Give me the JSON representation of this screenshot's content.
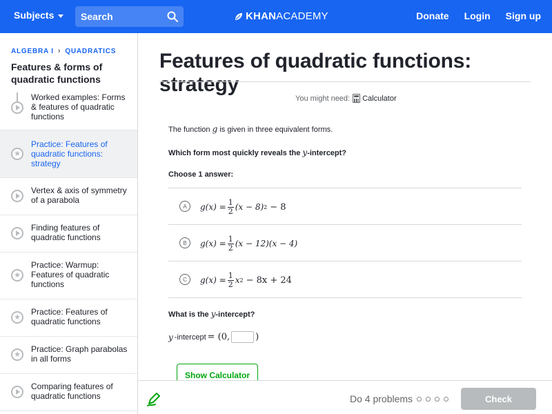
{
  "topbar": {
    "subjects_label": "Subjects",
    "search_placeholder": "Search",
    "logo_bold": "KHAN",
    "logo_light": "ACADEMY",
    "donate": "Donate",
    "login": "Login",
    "signup": "Sign up"
  },
  "sidebar": {
    "breadcrumb": [
      "ALGEBRA I",
      "QUADRATICS"
    ],
    "unit_title": "Features & forms of quadratic functions",
    "items": [
      {
        "label": "Worked examples: Forms & features of quadratic functions",
        "kind": "video",
        "active": false
      },
      {
        "label": "Practice: Features of quadratic functions: strategy",
        "kind": "practice",
        "active": true
      },
      {
        "label": "Vertex & axis of symmetry of a parabola",
        "kind": "video",
        "active": false
      },
      {
        "label": "Finding features of quadratic functions",
        "kind": "video",
        "active": false
      },
      {
        "label": "Practice: Warmup: Features of quadratic functions",
        "kind": "practice",
        "active": false
      },
      {
        "label": "Practice: Features of quadratic functions",
        "kind": "practice",
        "active": false
      },
      {
        "label": "Practice: Graph parabolas in all forms",
        "kind": "practice",
        "active": false
      },
      {
        "label": "Comparing features of quadratic functions",
        "kind": "video",
        "active": false
      }
    ]
  },
  "exercise": {
    "title": "Features of quadratic functions: strategy",
    "you_might_need": "You might need:",
    "calculator": "Calculator",
    "intro_before": "The function",
    "intro_var": "g",
    "intro_after": "is given in three equivalent forms.",
    "question_before": "Which form most quickly reveals the",
    "question_var": "y",
    "question_after": "-intercept?",
    "choose": "Choose 1 answer:",
    "choices": [
      {
        "letter": "A",
        "lhs": "g(x) =",
        "frac_num": "1",
        "frac_den": "2",
        "rhs": "(x − 8)",
        "sup": "2",
        "tail": "− 8"
      },
      {
        "letter": "B",
        "lhs": "g(x) =",
        "frac_num": "1",
        "frac_den": "2",
        "rhs": "(x − 12)(x − 4)",
        "sup": "",
        "tail": ""
      },
      {
        "letter": "C",
        "lhs": "g(x) =",
        "frac_num": "1",
        "frac_den": "2",
        "rhs": "x",
        "sup": "2",
        "tail": "− 8x + 24"
      }
    ],
    "second_question_before": "What is the",
    "second_question_var": "y",
    "second_question_after": "-intercept?",
    "answer_var": "y",
    "answer_label": "-intercept",
    "answer_prefix": "= (0,",
    "answer_suffix": ")",
    "answer_value": "",
    "show_calculator": "Show Calculator"
  },
  "footer": {
    "progress_text": "Do 4 problems",
    "progress_dots": 4,
    "check": "Check"
  },
  "colors": {
    "brand_blue": "#1865f2",
    "green": "#00a60e",
    "disabled_gray": "#b8bbbd"
  }
}
